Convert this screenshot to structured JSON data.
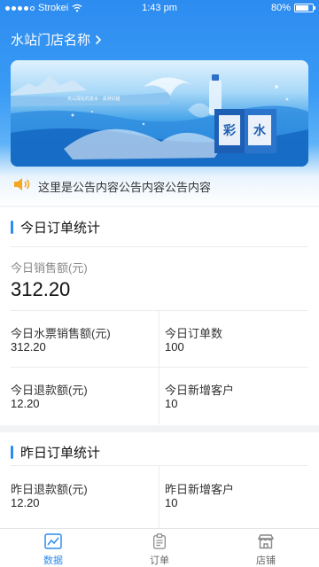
{
  "status_bar": {
    "carrier": "Strokei",
    "time": "1:43 pm",
    "battery": "80%",
    "battery_level": 0.8
  },
  "store": {
    "name": "水站门店名称",
    "chevron": "chevron-right-icon"
  },
  "banner": {
    "slogan": "天山深处的泉水 · 清洌甘甜",
    "brand_glyphs": "彩水"
  },
  "notice": {
    "icon": "speaker-icon",
    "text": "这里是公告内容公告内容公告内容"
  },
  "today": {
    "title": "今日订单统计",
    "sales_label": "今日销售额(元)",
    "sales_value": "312.20",
    "cells": [
      {
        "label": "今日水票销售额(元)",
        "value": "312.20"
      },
      {
        "label": "今日订单数",
        "value": "100"
      },
      {
        "label": "今日退款额(元)",
        "value": "12.20"
      },
      {
        "label": "今日新增客户",
        "value": "10"
      }
    ]
  },
  "yesterday": {
    "title": "昨日订单统计",
    "cells": [
      {
        "label": "昨日退款额(元)",
        "value": "12.20"
      },
      {
        "label": "昨日新增客户",
        "value": "10"
      }
    ]
  },
  "tabs": [
    {
      "label": "数据",
      "icon": "chart-icon",
      "active": true
    },
    {
      "label": "订单",
      "icon": "clipboard-icon",
      "active": false
    },
    {
      "label": "店铺",
      "icon": "store-icon",
      "active": false
    }
  ],
  "colors": {
    "accent": "#2d8cf0",
    "header_top": "#2d8cf0",
    "notice_icon": "#f5a623"
  }
}
